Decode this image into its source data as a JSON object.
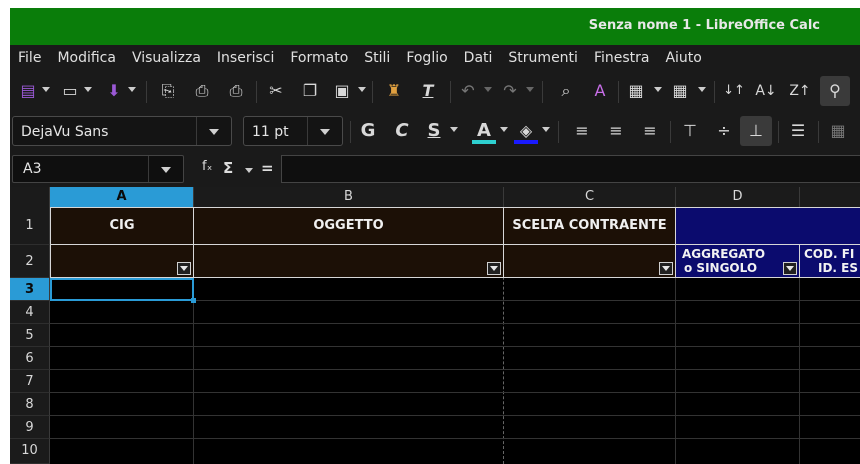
{
  "window": {
    "title": "Senza nome 1 - LibreOffice Calc"
  },
  "menu": [
    "File",
    "Modifica",
    "Visualizza",
    "Inserisci",
    "Formato",
    "Stili",
    "Foglio",
    "Dati",
    "Strumenti",
    "Finestra",
    "Aiuto"
  ],
  "font": {
    "name": "DejaVu Sans",
    "size": "11 pt"
  },
  "namebox": {
    "value": "A3"
  },
  "formula_bar": {
    "fx": "fₓ",
    "sum": "Σ",
    "equals": "="
  },
  "columns": [
    "A",
    "B",
    "C",
    "D"
  ],
  "rows": [
    "1",
    "2",
    "3",
    "4",
    "5",
    "6",
    "7",
    "8",
    "9",
    "10"
  ],
  "cells": {
    "a1": "CIG",
    "b1": "OGGETTO",
    "c1": "SCELTA CONTRAENTE",
    "d2_line1": "AGGREGATO",
    "d2_line2": "o SINGOLO",
    "e2_line1": "COD. FI",
    "e2_line2": "ID. ES"
  },
  "colors": {
    "titlebar": "#0a7d0a",
    "selection": "#2a9bd6",
    "header_fill": "#1c1006",
    "blue_fill": "#0b0b6e"
  }
}
